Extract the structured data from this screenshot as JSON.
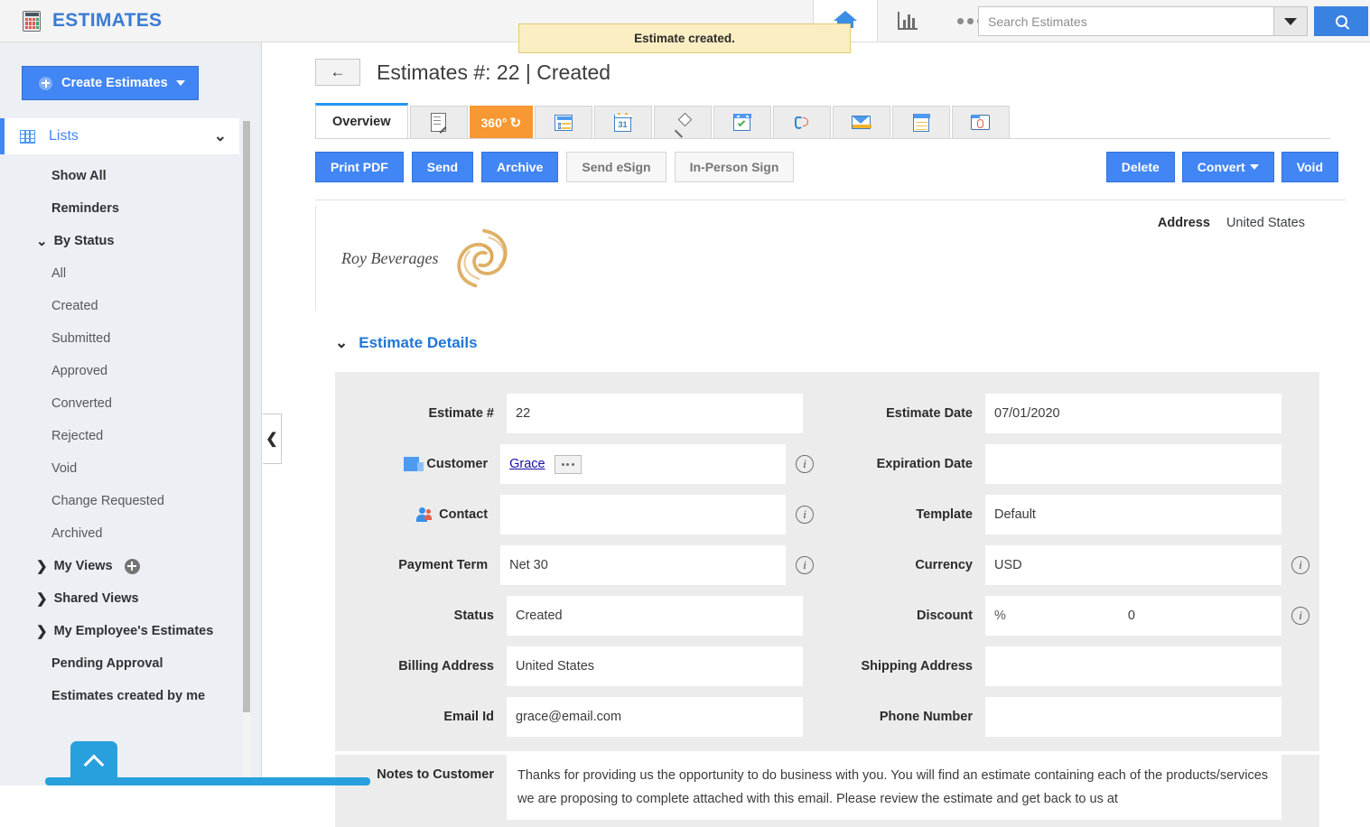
{
  "app": {
    "title": "ESTIMATES",
    "logo_icon": "calculator-icon"
  },
  "toast": {
    "message": "Estimate created."
  },
  "topbar": {
    "home_icon": "home-icon",
    "analytics_icon": "bar-chart-icon",
    "more_icon": "more-dots-icon"
  },
  "search": {
    "placeholder": "Search Estimates",
    "value": "",
    "dropdown_icon": "chevron-down-icon",
    "button_icon": "search-icon"
  },
  "sidebar": {
    "create_button": "Create Estimates",
    "lists_label": "Lists",
    "items": [
      {
        "label": "Show All",
        "style": "bold"
      },
      {
        "label": "Reminders",
        "style": "bold"
      },
      {
        "label": "By Status",
        "style": "group",
        "arrow": "⌃",
        "expanded": true
      },
      {
        "label": "All",
        "style": "sub"
      },
      {
        "label": "Created",
        "style": "sub"
      },
      {
        "label": "Submitted",
        "style": "sub"
      },
      {
        "label": "Approved",
        "style": "sub"
      },
      {
        "label": "Converted",
        "style": "sub"
      },
      {
        "label": "Rejected",
        "style": "sub"
      },
      {
        "label": "Void",
        "style": "sub"
      },
      {
        "label": "Change Requested",
        "style": "sub"
      },
      {
        "label": "Archived",
        "style": "sub"
      },
      {
        "label": "My Views",
        "style": "group",
        "arrow": "›",
        "expanded": false,
        "add": true
      },
      {
        "label": "Shared Views",
        "style": "group",
        "arrow": "›",
        "expanded": false
      },
      {
        "label": "My Employee's Estimates",
        "style": "group",
        "arrow": "›",
        "expanded": false
      },
      {
        "label": "Pending Approval",
        "style": "bold"
      },
      {
        "label": "Estimates created by me",
        "style": "bold"
      }
    ],
    "collapse_icon": "chevron-left-icon",
    "scroll_to_top_icon": "chevron-up-icon"
  },
  "header": {
    "back_icon": "back-arrow-icon",
    "title": "Estimates #: 22 | Created"
  },
  "tabs": [
    {
      "label": "Overview",
      "type": "text",
      "active": true
    },
    {
      "label": "",
      "type": "icon",
      "icon": "document-edit-icon"
    },
    {
      "label": "360°",
      "type": "orange",
      "icon": "360-refresh-icon"
    },
    {
      "label": "",
      "type": "icon",
      "icon": "details-list-icon"
    },
    {
      "label": "",
      "type": "icon",
      "icon": "calendar-31-icon"
    },
    {
      "label": "",
      "type": "icon",
      "icon": "pushpin-icon"
    },
    {
      "label": "",
      "type": "icon",
      "icon": "task-checkmark-icon"
    },
    {
      "label": "",
      "type": "icon",
      "icon": "phone-call-icon"
    },
    {
      "label": "",
      "type": "icon",
      "icon": "email-envelope-icon"
    },
    {
      "label": "",
      "type": "icon",
      "icon": "notes-icon"
    },
    {
      "label": "",
      "type": "icon",
      "icon": "attachment-folder-icon"
    }
  ],
  "actions": {
    "primary": [
      {
        "label": "Print PDF",
        "style": "primary"
      },
      {
        "label": "Send",
        "style": "primary"
      },
      {
        "label": "Archive",
        "style": "primary"
      },
      {
        "label": "Send eSign",
        "style": "ghost"
      },
      {
        "label": "In-Person Sign",
        "style": "ghost"
      }
    ],
    "right": [
      {
        "label": "Delete",
        "style": "primary"
      },
      {
        "label": "Convert",
        "style": "primary",
        "caret": true
      },
      {
        "label": "Void",
        "style": "primary"
      }
    ]
  },
  "document": {
    "address_label": "Address",
    "address_value": "United States",
    "company_logo_text": "Roy Beverages"
  },
  "estimate_details": {
    "section_title": "Estimate Details",
    "left_fields": [
      {
        "label": "Estimate #",
        "value": "22",
        "icon": "",
        "info": false
      },
      {
        "label": "Customer",
        "value": "Grace",
        "icon": "building-icon",
        "info": true,
        "link": true,
        "ellipsis": true
      },
      {
        "label": "Contact",
        "value": "",
        "icon": "people-icon",
        "info": true
      },
      {
        "label": "Payment Term",
        "value": "Net 30",
        "icon": "",
        "info": true
      },
      {
        "label": "Status",
        "value": "Created",
        "icon": "",
        "info": false
      },
      {
        "label": "Billing Address",
        "value": "United States",
        "icon": "",
        "info": false
      },
      {
        "label": "Email Id",
        "value": "grace@email.com",
        "icon": "",
        "info": false
      }
    ],
    "right_fields": [
      {
        "label": "Estimate Date",
        "value": "07/01/2020",
        "info": false
      },
      {
        "label": "Expiration Date",
        "value": "",
        "info": false
      },
      {
        "label": "Template",
        "value": "Default",
        "info": false
      },
      {
        "label": "Currency",
        "value": "USD",
        "info": true
      },
      {
        "label": "Discount",
        "value": "",
        "info": true,
        "discount": true,
        "pct": "%",
        "amount": "0"
      },
      {
        "label": "Shipping Address",
        "value": "",
        "info": false
      },
      {
        "label": "Phone Number",
        "value": "",
        "info": false
      }
    ],
    "notes_label": "Notes to Customer",
    "notes_value": "Thanks for providing us the opportunity to do business with you. You will find an estimate containing each of the products/services we are proposing to complete attached with this email. Please review the estimate and get back to us at"
  },
  "colors": {
    "accent_blue": "#4285f4",
    "link_blue": "#2176d6",
    "orange_tab": "#f79833",
    "toast_bg": "#faeec2",
    "sidebar_bg": "#eceff4",
    "panel_bg": "#ececec"
  }
}
